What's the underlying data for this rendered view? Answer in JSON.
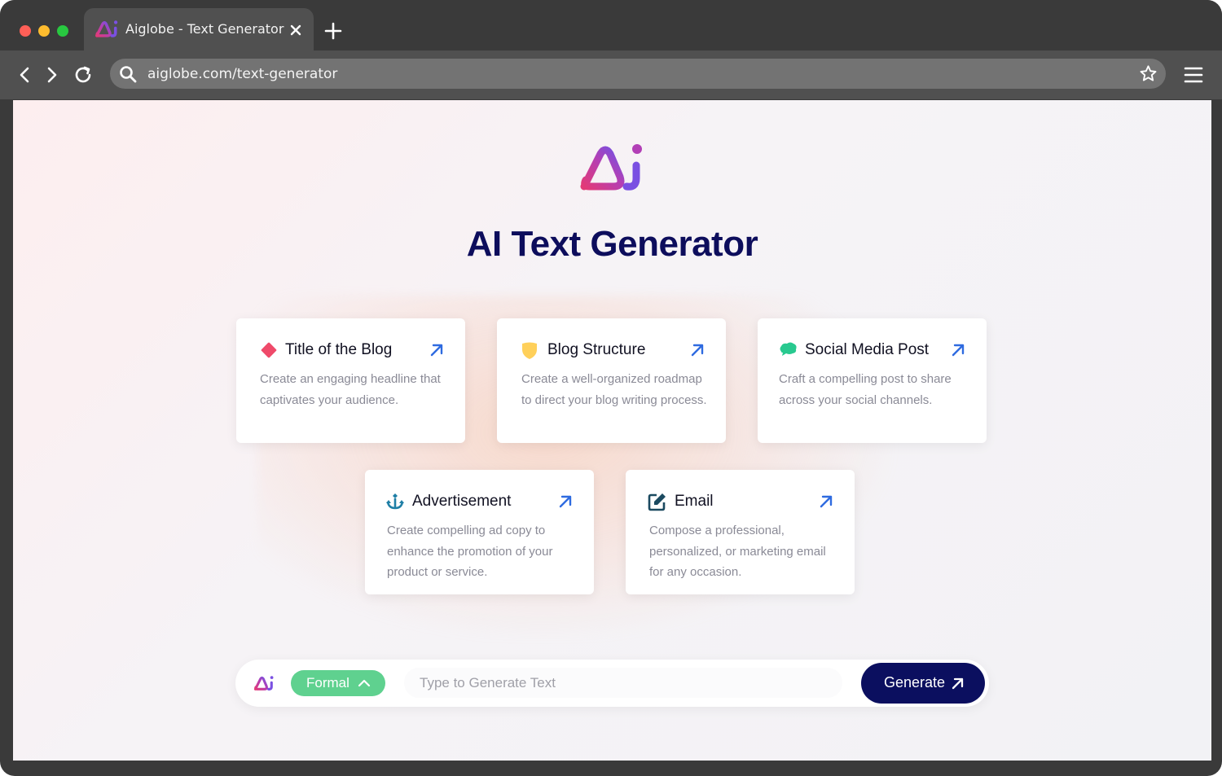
{
  "browser": {
    "tab_title": "Aiglobe - Text Generator",
    "url": "aiglobe.com/text-generator"
  },
  "page": {
    "title": "AI Text Generator"
  },
  "cards": [
    {
      "title": "Title of the Blog",
      "description": "Create an engaging headline that captivates your audience.",
      "icon": "diamond-icon"
    },
    {
      "title": "Blog Structure",
      "description": "Create a well-organized roadmap to direct your blog writing process.",
      "icon": "shield-icon"
    },
    {
      "title": "Social Media Post",
      "description": "Craft a compelling post to share across your social channels.",
      "icon": "chat-bubble-icon"
    },
    {
      "title": "Advertisement",
      "description": "Create compelling ad copy to enhance the promotion of your product or service.",
      "icon": "anchor-icon"
    },
    {
      "title": "Email",
      "description": "Compose a professional, personalized, or marketing email for any occasion.",
      "icon": "edit-icon"
    }
  ],
  "prompt": {
    "tone": "Formal",
    "placeholder": "Type to Generate Text",
    "generate_label": "Generate"
  },
  "colors": {
    "brand_navy": "#0b0f5f",
    "tone_green": "#5fd18f",
    "arrow_blue": "#2f6be0",
    "logo_gradient_start": "#e0397a",
    "logo_gradient_end": "#7b4fe0"
  }
}
